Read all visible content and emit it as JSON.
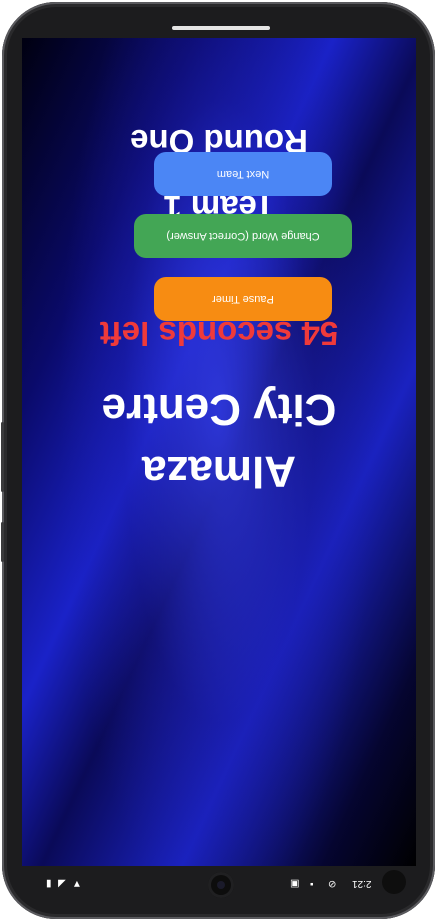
{
  "game": {
    "round": "Round One",
    "team": "Team 1",
    "timer": "54 seconds left",
    "word_line1": "City Centre",
    "word_line2": "Almaza"
  },
  "buttons": {
    "next_team": "Next Team",
    "change_word": "Change Word (Correct Answer)",
    "pause_timer": "Pause Timer"
  },
  "status_bar": {
    "time": "2:21"
  },
  "colors": {
    "next_team_button": "#4b86f5",
    "change_word_button": "#43a655",
    "pause_timer_button": "#f78c12",
    "timer_text": "#ef3a3a"
  }
}
